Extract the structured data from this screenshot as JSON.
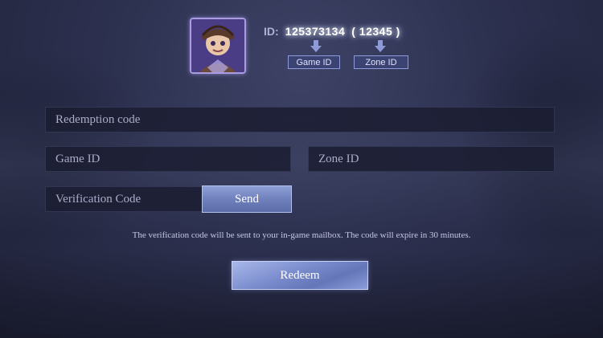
{
  "profile": {
    "avatar_icon": "hero-avatar-icon",
    "id_label": "ID:",
    "game_id": "125373134",
    "zone_id_display": "( 12345 )",
    "game_id_tag": "Game ID",
    "zone_id_tag": "Zone ID",
    "arrow_icon": "arrow-down-icon"
  },
  "form": {
    "redemption_placeholder": "Redemption code",
    "game_id_placeholder": "Game ID",
    "zone_id_placeholder": "Zone ID",
    "verification_placeholder": "Verification Code",
    "send_label": "Send",
    "notice": "The verification code will be sent to your in-game mailbox. The code will expire in 30 minutes.",
    "redeem_label": "Redeem"
  },
  "colors": {
    "accent": "#7d8fcf",
    "background": "#2d3150",
    "field": "#1b1e32"
  }
}
